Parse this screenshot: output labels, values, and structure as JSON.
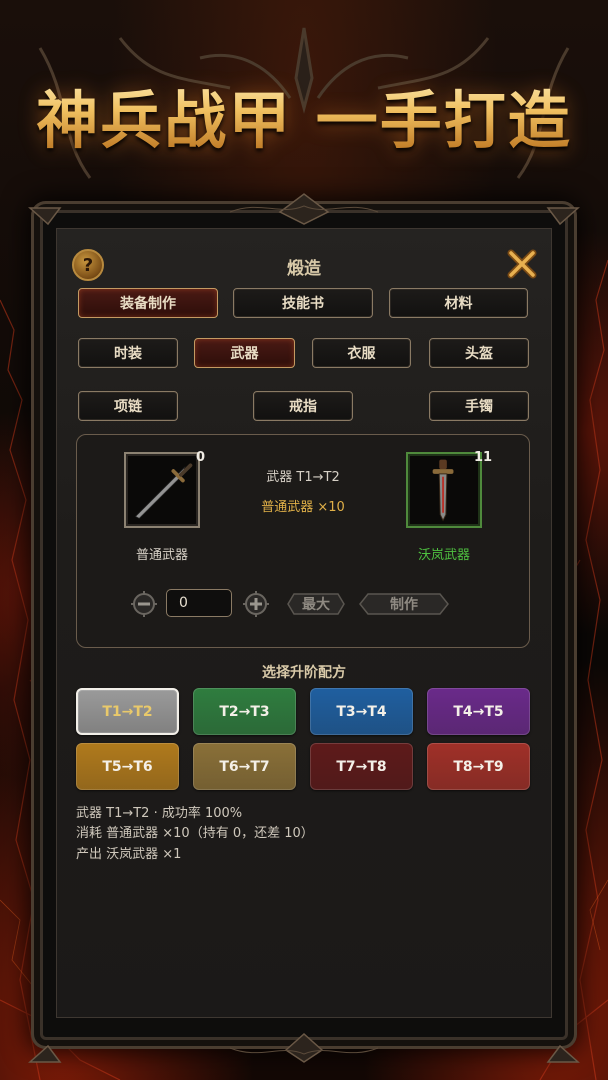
{
  "banner": {
    "headline": "神兵战甲 一手打造"
  },
  "dialog": {
    "title": "煅造",
    "help_glyph": "?"
  },
  "category_tabs": [
    {
      "label": "装备制作",
      "active": true
    },
    {
      "label": "技能书",
      "active": false
    },
    {
      "label": "材料",
      "active": false
    }
  ],
  "equipment_types": [
    {
      "label": "时装",
      "active": false
    },
    {
      "label": "武器",
      "active": true
    },
    {
      "label": "衣服",
      "active": false
    },
    {
      "label": "头盔",
      "active": false
    },
    {
      "label": "项链",
      "active": false
    },
    {
      "label": "戒指",
      "active": false
    },
    {
      "label": "手镯",
      "active": false
    }
  ],
  "craft": {
    "input_item": {
      "name": "普通武器",
      "count": "0",
      "icon": "sword-icon"
    },
    "recipe_line": "武器 T1→T2",
    "cost_line": "普通武器 ×10",
    "output_item": {
      "name": "沃岚武器",
      "count": "11",
      "icon": "ornate-sword-icon"
    },
    "quantity": "0",
    "max_label": "最大",
    "craft_label": "制作"
  },
  "recipes": {
    "section_title": "选择升阶配方",
    "tiers": [
      {
        "label": "T1→T2",
        "color": "#9a9a9a",
        "selected": true
      },
      {
        "label": "T2→T3",
        "color": "#2f7d3f",
        "selected": false
      },
      {
        "label": "T3→T4",
        "color": "#1f5fa0",
        "selected": false
      },
      {
        "label": "T4→T5",
        "color": "#6a2a8a",
        "selected": false
      },
      {
        "label": "T5→T6",
        "color": "#b07a1c",
        "selected": false
      },
      {
        "label": "T6→T7",
        "color": "#8a7038",
        "selected": false
      },
      {
        "label": "T7→T8",
        "color": "#5e1a1a",
        "selected": false
      },
      {
        "label": "T8→T9",
        "color": "#a03028",
        "selected": false
      }
    ]
  },
  "details": [
    "武器 T1→T2 · 成功率 100%",
    "消耗 普通武器 ×10（持有 0，还差 10）",
    "产出 沃岚武器 ×1"
  ]
}
